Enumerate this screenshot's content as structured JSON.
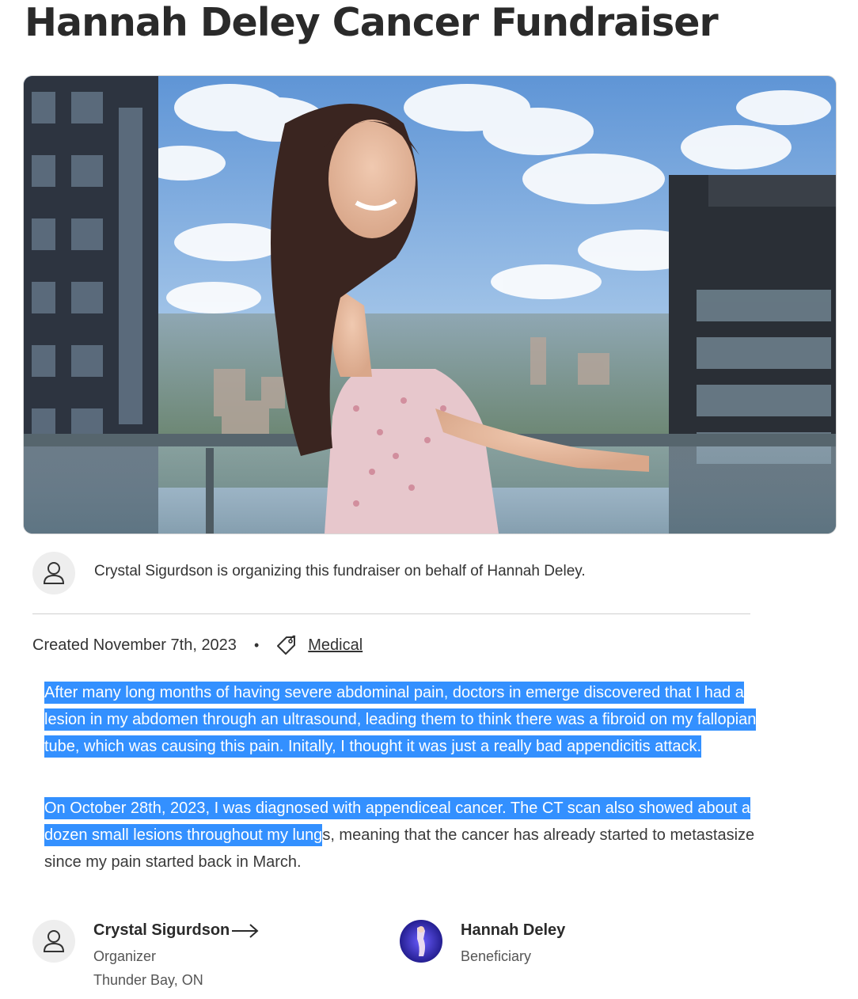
{
  "page": {
    "title": "Hannah Deley Cancer Fundraiser"
  },
  "hero": {
    "image_alt": "Woman in a floral dress leaning on a balcony railing above a city skyline"
  },
  "organizer_notice": {
    "icon": "user-icon",
    "text": "Crystal Sigurdson is organizing this fundraiser on behalf of Hannah Deley."
  },
  "meta": {
    "created": "Created November 7th, 2023",
    "separator": "•",
    "category_icon": "tag-icon",
    "category": "Medical"
  },
  "story": {
    "p1_highlighted": "After many long months of having severe abdominal pain, doctors in emerge discovered that I had a lesion in my abdomen through an ultrasound, leading them to think there was a fibroid on my fallopian tube, which was causing this pain. Initally, I thought it was just a really bad appendicitis attack.",
    "p2_highlighted": "On October 28th, 2023, I was diagnosed with appendiceal cancer. The CT scan also showed about a dozen small lesions throughout my lung",
    "p2_rest": "s, meaning that the cancer has already started to metastasize since my pain started back in March."
  },
  "organizer": {
    "name": "Crystal Sigurdson",
    "role": "Organizer",
    "location": "Thunder Bay, ON",
    "arrow_icon": "arrow-right-icon"
  },
  "beneficiary": {
    "name": "Hannah Deley",
    "role": "Beneficiary"
  },
  "colors": {
    "highlight": "#3390ff",
    "text": "#333333"
  }
}
